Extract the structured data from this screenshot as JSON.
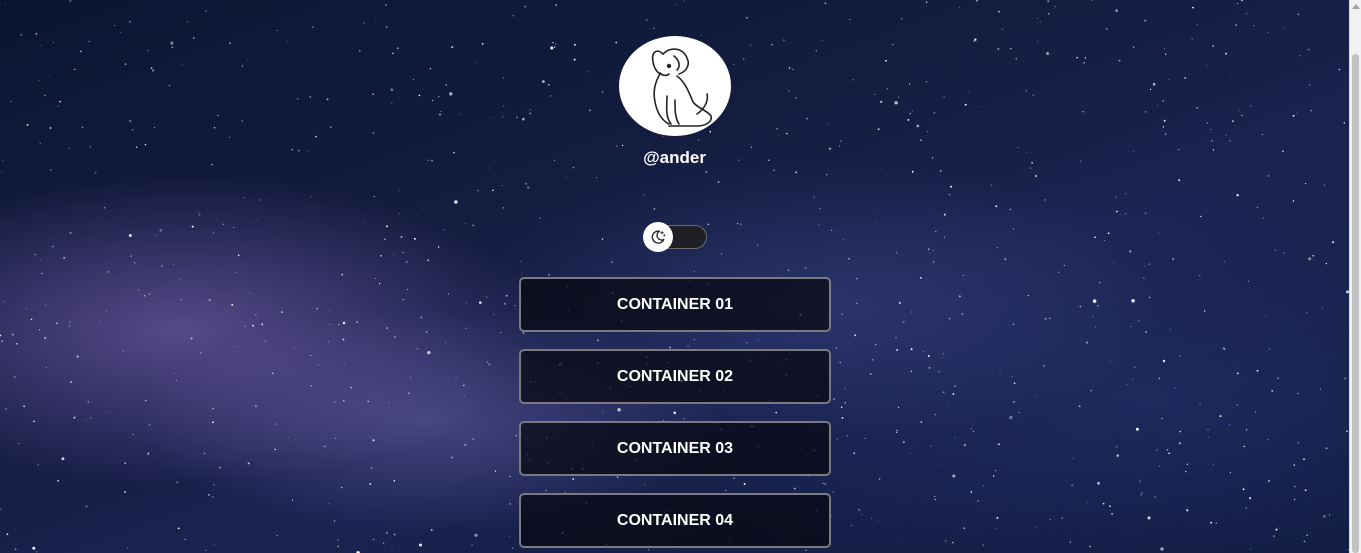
{
  "profile": {
    "username": "@ander",
    "avatar_icon": "dog-illustration-icon"
  },
  "theme_toggle": {
    "icon": "moon-stars-icon",
    "state": "dark"
  },
  "links": [
    {
      "label": "CONTAINER 01"
    },
    {
      "label": "CONTAINER 02"
    },
    {
      "label": "CONTAINER 03"
    },
    {
      "label": "CONTAINER 04"
    }
  ],
  "colors": {
    "button_border": "#7a7a80",
    "button_bg": "#0a0a14",
    "text": "#ffffff"
  }
}
